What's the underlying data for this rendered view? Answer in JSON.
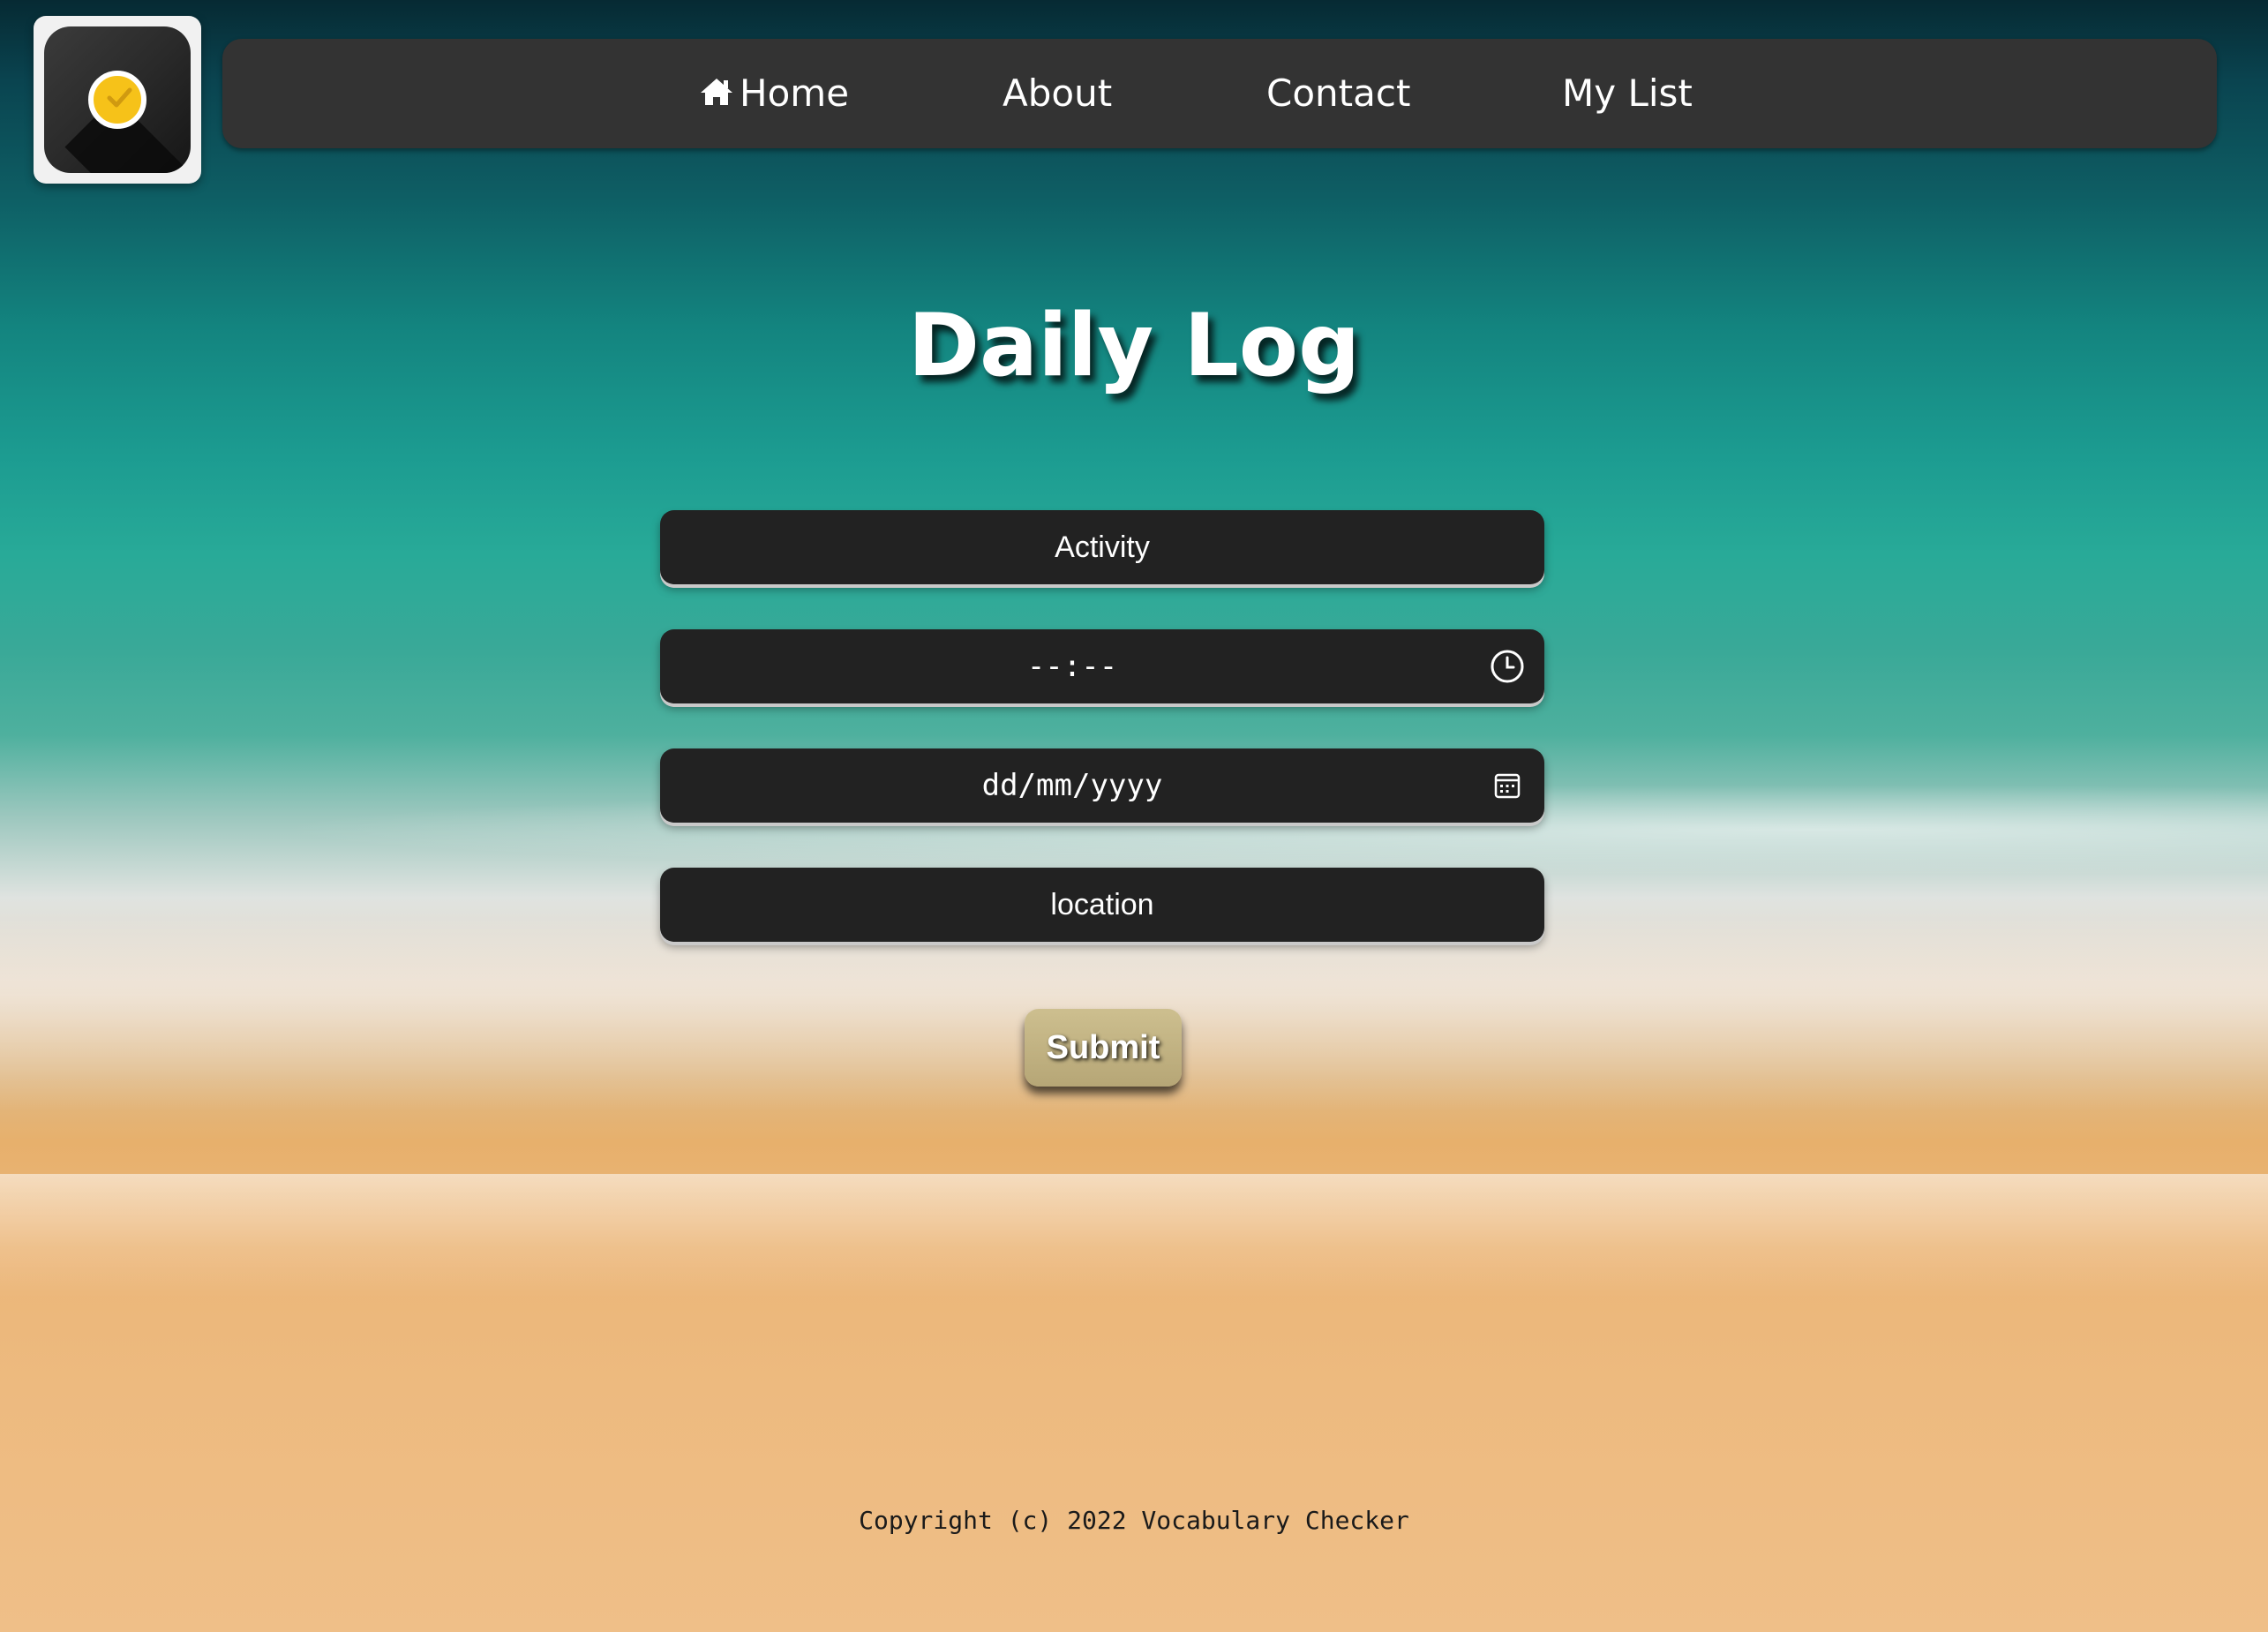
{
  "logo": {
    "icon": "checkmark-badge-icon",
    "accent_color": "#f6c219"
  },
  "nav": {
    "items": [
      {
        "label": "Home",
        "icon": "home-icon"
      },
      {
        "label": "About"
      },
      {
        "label": "Contact"
      },
      {
        "label": "My List"
      }
    ]
  },
  "page": {
    "title": "Daily Log"
  },
  "form": {
    "activity": {
      "placeholder": "Activity"
    },
    "time": {
      "value": "--:--",
      "icon": "clock-icon"
    },
    "date": {
      "value": "dd/mm/yyyy",
      "icon": "calendar-icon"
    },
    "location": {
      "placeholder": "location"
    },
    "submit_label": "Submit"
  },
  "footer": {
    "text": "Copyright (c) 2022 Vocabulary Checker"
  },
  "colors": {
    "nav_bg": "#333333",
    "field_bg": "#222222",
    "submit_bg": "#c2b282"
  }
}
